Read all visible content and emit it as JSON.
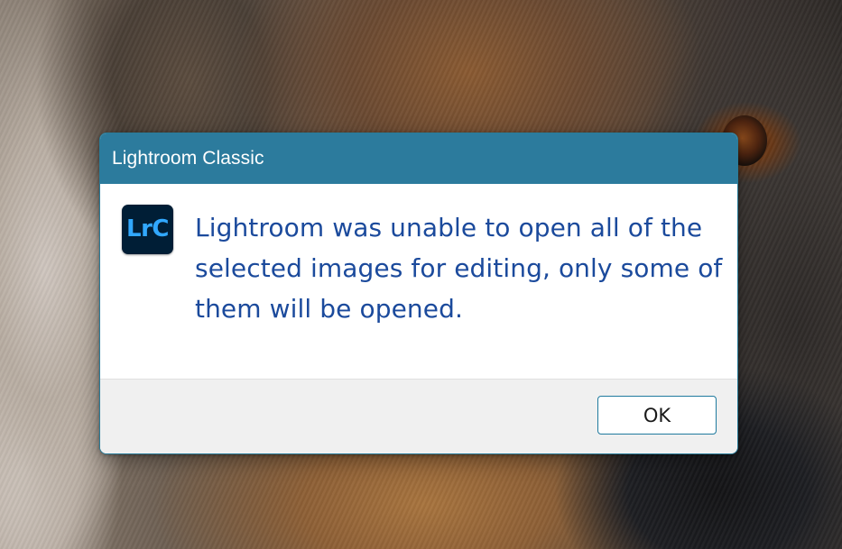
{
  "dialog": {
    "title": "Lightroom Classic",
    "app_icon": {
      "name": "lightroom-classic-icon",
      "label": "LrC",
      "background_color": "#001e36",
      "label_color": "#31a8ff"
    },
    "message": "Lightroom was unable to open all of the selected images for editing, only some of them will be opened.",
    "ok_label": "OK"
  },
  "colors": {
    "titlebar": "#2c7b9d",
    "message_text": "#1b4a9c",
    "footer": "#f0f0f0",
    "button_border": "#1f7a9e"
  }
}
